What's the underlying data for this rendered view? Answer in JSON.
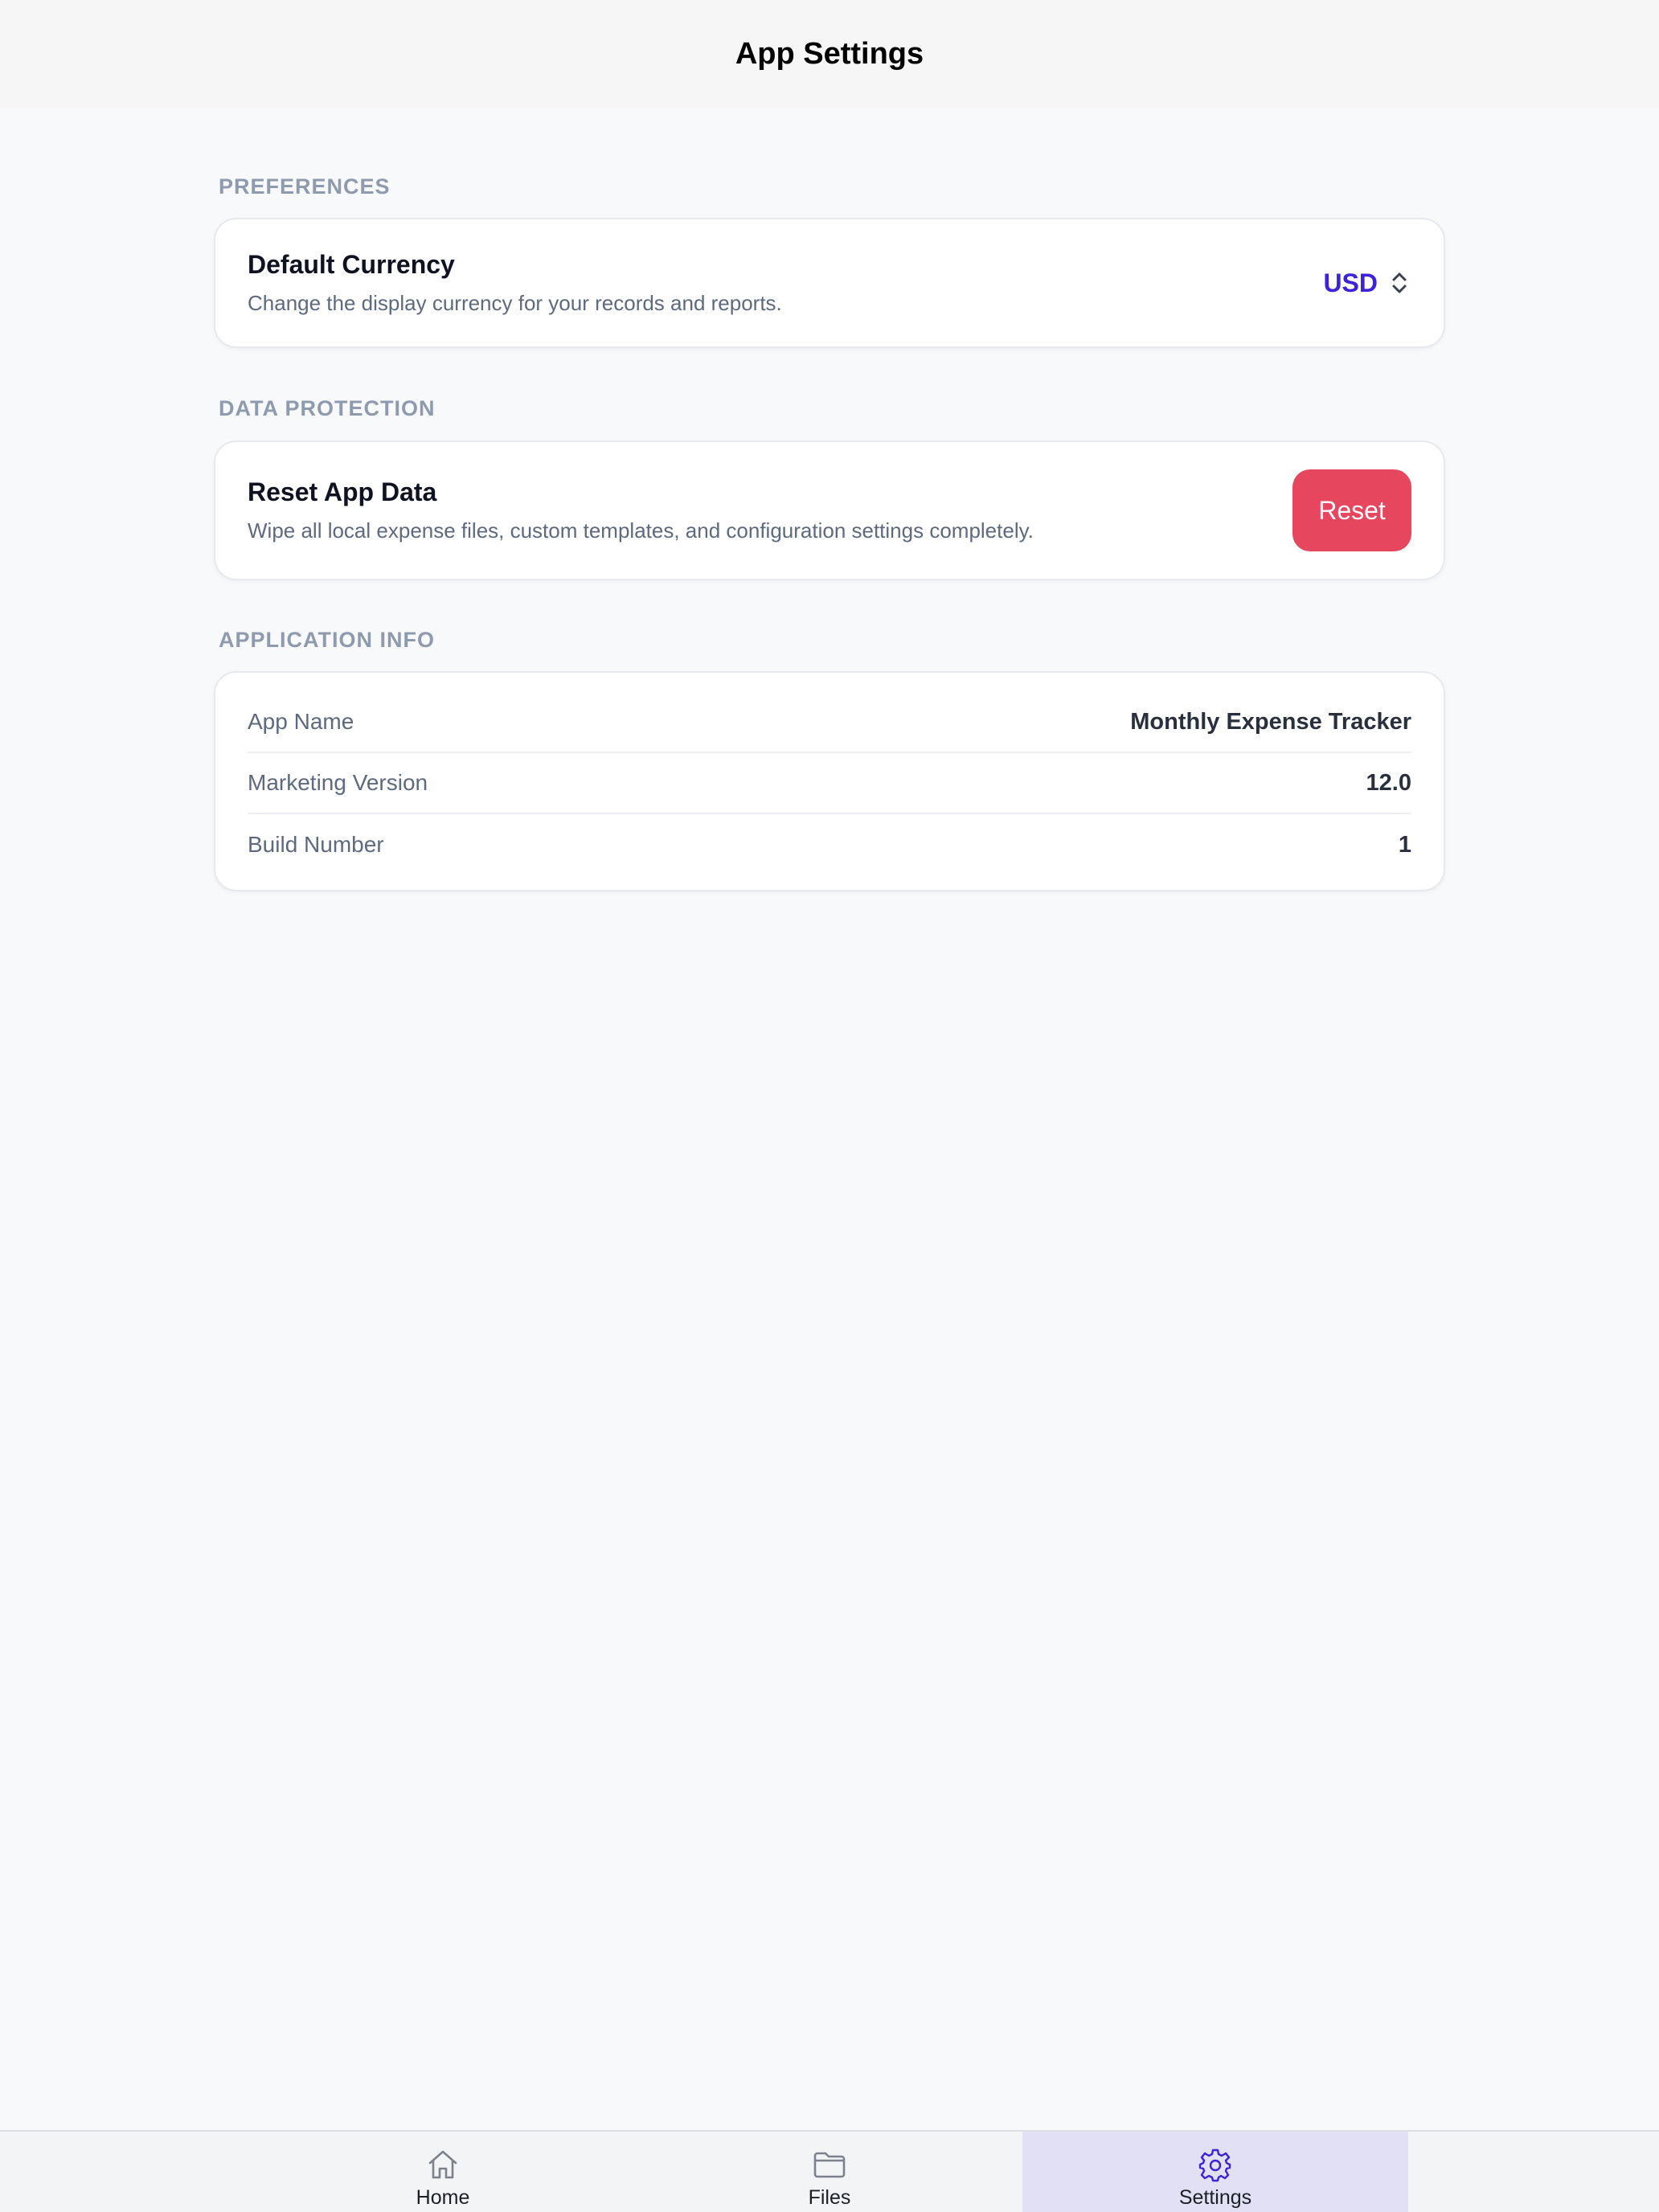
{
  "header": {
    "title": "App Settings"
  },
  "preferences": {
    "section_label": "PREFERENCES",
    "currency": {
      "title": "Default Currency",
      "description": "Change the display currency for your records and reports.",
      "value": "USD",
      "icon": "chevron-up-down-icon"
    }
  },
  "data_protection": {
    "section_label": "DATA PROTECTION",
    "reset": {
      "title": "Reset App Data",
      "description": "Wipe all local expense files, custom templates, and configuration settings completely.",
      "button_label": "Reset"
    }
  },
  "application_info": {
    "section_label": "APPLICATION INFO",
    "rows": [
      {
        "key": "App Name",
        "value": "Monthly Expense Tracker"
      },
      {
        "key": "Marketing Version",
        "value": "12.0"
      },
      {
        "key": "Build Number",
        "value": "1"
      }
    ]
  },
  "tabbar": {
    "items": [
      {
        "label": "Home",
        "icon": "home-icon",
        "active": false
      },
      {
        "label": "Files",
        "icon": "folder-icon",
        "active": false
      },
      {
        "label": "Settings",
        "icon": "gear-icon",
        "active": true
      }
    ]
  },
  "colors": {
    "accent": "#3c22d8",
    "danger": "#e7465f",
    "active_tab_bg": "#e1e0f4"
  }
}
